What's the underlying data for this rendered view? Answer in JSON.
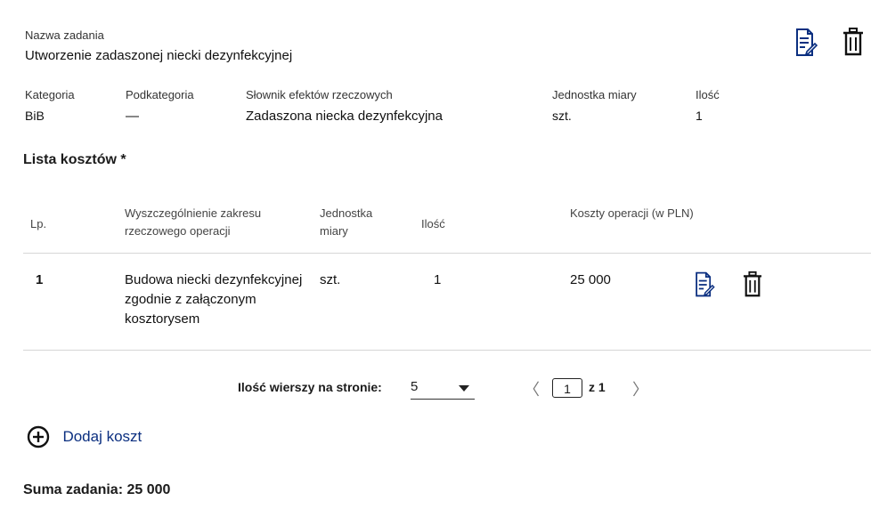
{
  "task": {
    "name_label": "Nazwa zadania",
    "name_value": "Utworzenie zadaszonej niecki dezynfekcyjnej",
    "fields": [
      {
        "label": "Kategoria",
        "value": "BiB"
      },
      {
        "label": "Podkategoria",
        "value": "—"
      },
      {
        "label": "Słownik efektów rzeczowych",
        "value": "Zadaszona niecka dezynfekcyjna"
      },
      {
        "label": "Jednostka miary",
        "value": "szt."
      },
      {
        "label": "Ilość",
        "value": "1"
      }
    ]
  },
  "costs": {
    "heading": "Lista kosztów *",
    "columns": {
      "lp": "Lp.",
      "desc": "Wyszczególnienie zakresu rzeczowego operacji",
      "unit": "Jednostka miary",
      "qty": "Ilość",
      "cost": "Koszty operacji (w PLN)"
    },
    "rows": [
      {
        "lp": "1",
        "desc": "Budowa niecki dezynfekcyjnej zgodnie z załączonym kosztorysem",
        "unit": "szt.",
        "qty": "1",
        "cost": "25 000"
      }
    ]
  },
  "pagination": {
    "rows_per_page_label": "Ilość wierszy na stronie:",
    "rows_per_page_value": "5",
    "current_page": "1",
    "total_pages": "z 1",
    "prev_glyph": "〈",
    "next_glyph": "〉"
  },
  "add_cost": {
    "label": "Dodaj koszt",
    "icon": "plus-circle-icon"
  },
  "summary": {
    "label": "Suma zadania: 25 000"
  },
  "icons": {
    "edit": "edit-document-icon",
    "delete": "trash-icon"
  },
  "colors": {
    "accent": "#0b2f80",
    "divider": "#d6d6d6"
  }
}
